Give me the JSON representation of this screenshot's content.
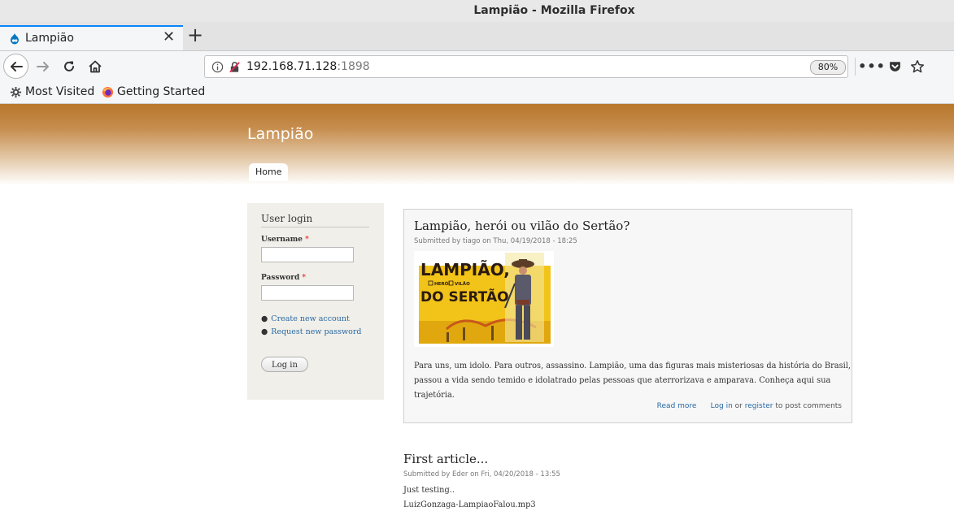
{
  "window": {
    "title": "Lampião - Mozilla Firefox"
  },
  "tab": {
    "label": "Lampião"
  },
  "address": {
    "host": "192.168.71.128",
    "port": ":1898",
    "zoom": "80%"
  },
  "bookmarks": {
    "most_visited": "Most Visited",
    "getting_started": "Getting Started"
  },
  "site": {
    "name": "Lampião",
    "nav_home": "Home"
  },
  "login": {
    "title": "User login",
    "username_label": "Username",
    "password_label": "Password",
    "required_mark": "*",
    "bullet": "●",
    "create_account": "Create new account",
    "request_password": "Request new password",
    "login_button": "Log in"
  },
  "articles": [
    {
      "title": "Lampião, herói ou vilão do Sertão?",
      "submitted": "Submitted by tiago on Thu, 04/19/2018 - 18:25",
      "image": {
        "line1": "LAMPIÃO,",
        "opt1": "HERÓI",
        "opt2": "VILÃO",
        "line2": "DO SERTÃO"
      },
      "body_line1": "Para uns, um idolo. Para outros, assassino. Lampião, uma das figuras mais misteriosas da história do Brasil,",
      "body_line2": "passou a vida sendo temido e idolatrado pelas pessoas que aterrorizava e amparava. Conheça aqui sua trajetória.",
      "read_more": "Read more",
      "log_in": "Log in",
      "or": "or",
      "register": "register",
      "to_post": "to post comments"
    },
    {
      "title": "First article...",
      "submitted": "Submitted by Eder on Fri, 04/20/2018 - 13:55",
      "body_line1": "Just testing..",
      "body_line2": "LuizGonzaga-LampiaoFalou.mp3"
    }
  ],
  "colors": {
    "header_top": "#b8772c",
    "link": "#2a69a5",
    "sidebar_bg": "#f0efe9",
    "tab_accent": "#0a84ff"
  }
}
